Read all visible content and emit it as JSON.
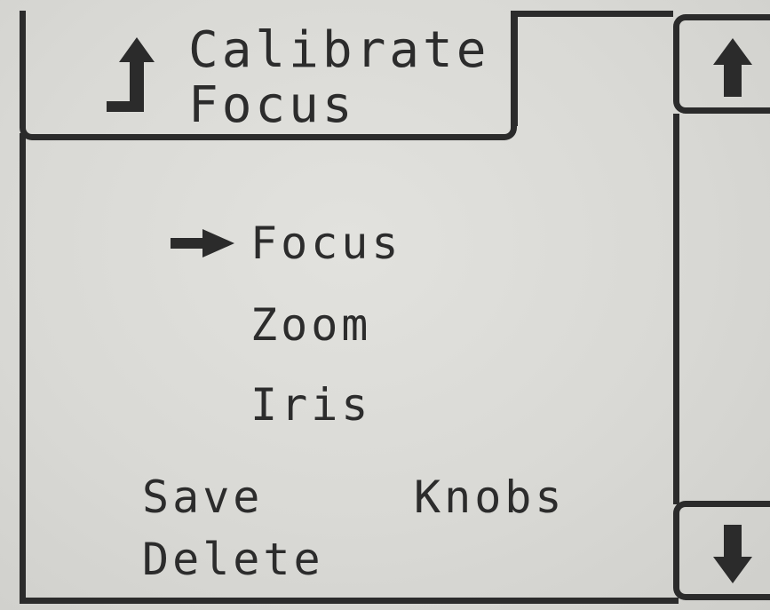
{
  "header": {
    "title_line1": "Calibrate",
    "title_line2": "Focus",
    "back_icon": "return-arrow-icon"
  },
  "menu": {
    "selected_index": 0,
    "items": [
      {
        "label": "Focus"
      },
      {
        "label": "Zoom"
      },
      {
        "label": "Iris"
      }
    ],
    "pointer_icon": "selection-pointer-icon"
  },
  "soft_keys": {
    "save": "Save",
    "knobs": "Knobs",
    "delete": "Delete"
  },
  "scroll": {
    "up_icon": "arrow-up-icon",
    "down_icon": "arrow-down-icon"
  },
  "colors": {
    "lcd_background": "#d6d6d2",
    "ink": "#2b2b2b"
  }
}
